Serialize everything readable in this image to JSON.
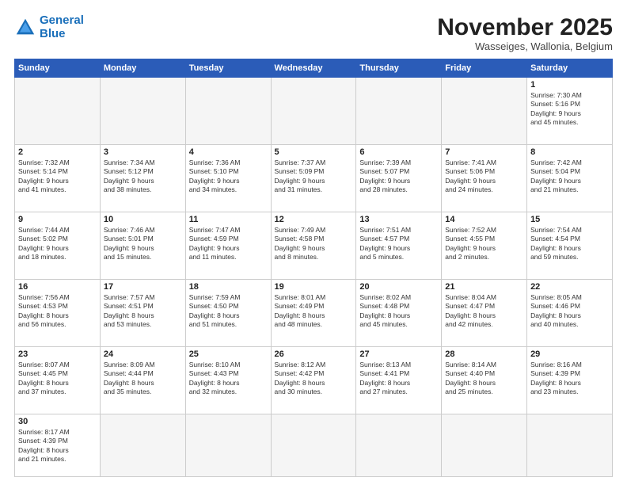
{
  "header": {
    "logo_line1": "General",
    "logo_line2": "Blue",
    "month_title": "November 2025",
    "subtitle": "Wasseiges, Wallonia, Belgium"
  },
  "days_of_week": [
    "Sunday",
    "Monday",
    "Tuesday",
    "Wednesday",
    "Thursday",
    "Friday",
    "Saturday"
  ],
  "weeks": [
    [
      {
        "day": "",
        "info": ""
      },
      {
        "day": "",
        "info": ""
      },
      {
        "day": "",
        "info": ""
      },
      {
        "day": "",
        "info": ""
      },
      {
        "day": "",
        "info": ""
      },
      {
        "day": "",
        "info": ""
      },
      {
        "day": "1",
        "info": "Sunrise: 7:30 AM\nSunset: 5:16 PM\nDaylight: 9 hours\nand 45 minutes."
      }
    ],
    [
      {
        "day": "2",
        "info": "Sunrise: 7:32 AM\nSunset: 5:14 PM\nDaylight: 9 hours\nand 41 minutes."
      },
      {
        "day": "3",
        "info": "Sunrise: 7:34 AM\nSunset: 5:12 PM\nDaylight: 9 hours\nand 38 minutes."
      },
      {
        "day": "4",
        "info": "Sunrise: 7:36 AM\nSunset: 5:10 PM\nDaylight: 9 hours\nand 34 minutes."
      },
      {
        "day": "5",
        "info": "Sunrise: 7:37 AM\nSunset: 5:09 PM\nDaylight: 9 hours\nand 31 minutes."
      },
      {
        "day": "6",
        "info": "Sunrise: 7:39 AM\nSunset: 5:07 PM\nDaylight: 9 hours\nand 28 minutes."
      },
      {
        "day": "7",
        "info": "Sunrise: 7:41 AM\nSunset: 5:06 PM\nDaylight: 9 hours\nand 24 minutes."
      },
      {
        "day": "8",
        "info": "Sunrise: 7:42 AM\nSunset: 5:04 PM\nDaylight: 9 hours\nand 21 minutes."
      }
    ],
    [
      {
        "day": "9",
        "info": "Sunrise: 7:44 AM\nSunset: 5:02 PM\nDaylight: 9 hours\nand 18 minutes."
      },
      {
        "day": "10",
        "info": "Sunrise: 7:46 AM\nSunset: 5:01 PM\nDaylight: 9 hours\nand 15 minutes."
      },
      {
        "day": "11",
        "info": "Sunrise: 7:47 AM\nSunset: 4:59 PM\nDaylight: 9 hours\nand 11 minutes."
      },
      {
        "day": "12",
        "info": "Sunrise: 7:49 AM\nSunset: 4:58 PM\nDaylight: 9 hours\nand 8 minutes."
      },
      {
        "day": "13",
        "info": "Sunrise: 7:51 AM\nSunset: 4:57 PM\nDaylight: 9 hours\nand 5 minutes."
      },
      {
        "day": "14",
        "info": "Sunrise: 7:52 AM\nSunset: 4:55 PM\nDaylight: 9 hours\nand 2 minutes."
      },
      {
        "day": "15",
        "info": "Sunrise: 7:54 AM\nSunset: 4:54 PM\nDaylight: 8 hours\nand 59 minutes."
      }
    ],
    [
      {
        "day": "16",
        "info": "Sunrise: 7:56 AM\nSunset: 4:53 PM\nDaylight: 8 hours\nand 56 minutes."
      },
      {
        "day": "17",
        "info": "Sunrise: 7:57 AM\nSunset: 4:51 PM\nDaylight: 8 hours\nand 53 minutes."
      },
      {
        "day": "18",
        "info": "Sunrise: 7:59 AM\nSunset: 4:50 PM\nDaylight: 8 hours\nand 51 minutes."
      },
      {
        "day": "19",
        "info": "Sunrise: 8:01 AM\nSunset: 4:49 PM\nDaylight: 8 hours\nand 48 minutes."
      },
      {
        "day": "20",
        "info": "Sunrise: 8:02 AM\nSunset: 4:48 PM\nDaylight: 8 hours\nand 45 minutes."
      },
      {
        "day": "21",
        "info": "Sunrise: 8:04 AM\nSunset: 4:47 PM\nDaylight: 8 hours\nand 42 minutes."
      },
      {
        "day": "22",
        "info": "Sunrise: 8:05 AM\nSunset: 4:46 PM\nDaylight: 8 hours\nand 40 minutes."
      }
    ],
    [
      {
        "day": "23",
        "info": "Sunrise: 8:07 AM\nSunset: 4:45 PM\nDaylight: 8 hours\nand 37 minutes."
      },
      {
        "day": "24",
        "info": "Sunrise: 8:09 AM\nSunset: 4:44 PM\nDaylight: 8 hours\nand 35 minutes."
      },
      {
        "day": "25",
        "info": "Sunrise: 8:10 AM\nSunset: 4:43 PM\nDaylight: 8 hours\nand 32 minutes."
      },
      {
        "day": "26",
        "info": "Sunrise: 8:12 AM\nSunset: 4:42 PM\nDaylight: 8 hours\nand 30 minutes."
      },
      {
        "day": "27",
        "info": "Sunrise: 8:13 AM\nSunset: 4:41 PM\nDaylight: 8 hours\nand 27 minutes."
      },
      {
        "day": "28",
        "info": "Sunrise: 8:14 AM\nSunset: 4:40 PM\nDaylight: 8 hours\nand 25 minutes."
      },
      {
        "day": "29",
        "info": "Sunrise: 8:16 AM\nSunset: 4:39 PM\nDaylight: 8 hours\nand 23 minutes."
      }
    ],
    [
      {
        "day": "30",
        "info": "Sunrise: 8:17 AM\nSunset: 4:39 PM\nDaylight: 8 hours\nand 21 minutes."
      },
      {
        "day": "",
        "info": ""
      },
      {
        "day": "",
        "info": ""
      },
      {
        "day": "",
        "info": ""
      },
      {
        "day": "",
        "info": ""
      },
      {
        "day": "",
        "info": ""
      },
      {
        "day": "",
        "info": ""
      }
    ]
  ]
}
